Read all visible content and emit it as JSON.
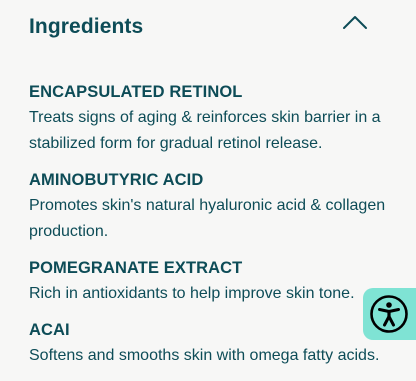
{
  "accordion": {
    "title": "Ingredients",
    "toggle_icon": "chevron-up-icon",
    "expanded": true
  },
  "ingredients": [
    {
      "name": "ENCAPSULATED RETINOL",
      "description": "Treats signs of aging & reinforces skin barrier in a stabilized form for gradual retinol release."
    },
    {
      "name": "AMINOBUTYRIC ACID",
      "description": "Promotes skin's natural hyaluronic acid & collagen production."
    },
    {
      "name": "POMEGRANATE EXTRACT",
      "description": "Rich in antioxidants to help improve skin tone."
    },
    {
      "name": "ACAI",
      "description": "Softens and smooths skin with omega fatty acids."
    }
  ],
  "accessibility_widget": {
    "icon": "accessibility-icon",
    "color": "#7fe3d4"
  },
  "colors": {
    "text": "#0d4c57",
    "background": "#f7f7f6"
  }
}
